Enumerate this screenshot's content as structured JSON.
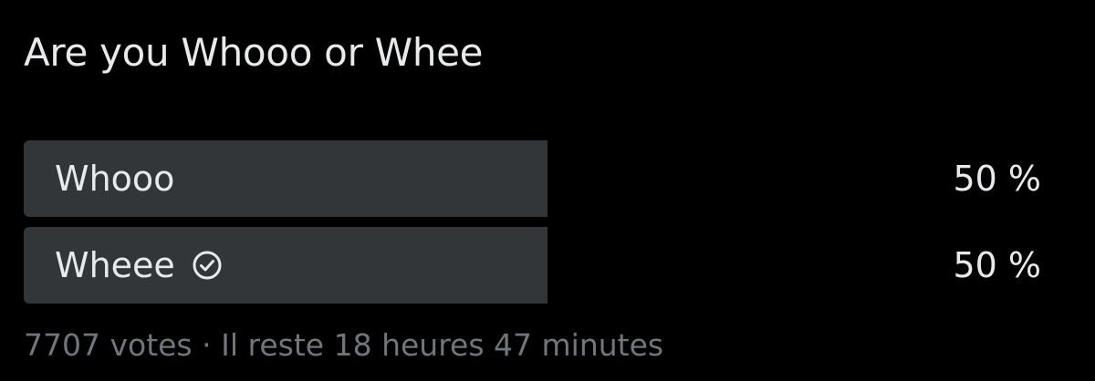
{
  "poll": {
    "question": "Are you Whooo or Whee",
    "options": [
      {
        "label": "Whooo",
        "percent": "50 %",
        "share": 0.5,
        "selected": false
      },
      {
        "label": "Wheee",
        "percent": "50 %",
        "share": 0.5,
        "selected": true
      }
    ],
    "selected_icon": "check-circle-icon",
    "votes": "7707 votes",
    "separator": "·",
    "time_left": "Il reste 18 heures 47 minutes"
  },
  "colors": {
    "background": "#000000",
    "bar": "#333639",
    "text": "#e7e9ea",
    "muted": "#71767b"
  }
}
